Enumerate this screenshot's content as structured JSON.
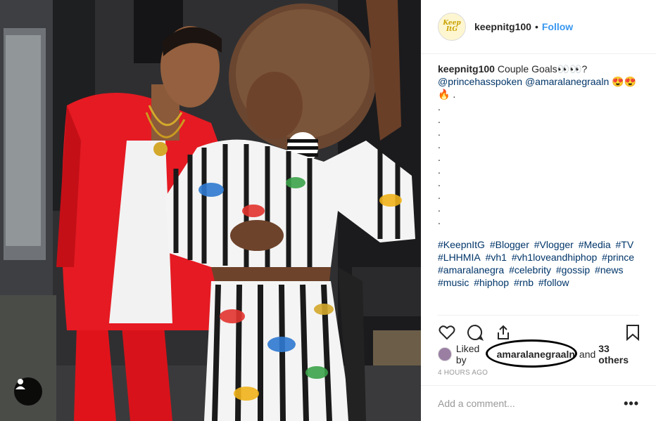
{
  "header": {
    "avatar_text": "Keep ItG",
    "username": "keepnitg100",
    "separator": "•",
    "follow_label": "Follow"
  },
  "caption": {
    "username": "keepnitg100",
    "text": "Couple Goals👀👀?",
    "mention_1": "@princehasspoken",
    "mention_2": "@amaralanegraaln",
    "emoji_1": "😍😍",
    "emoji_2": "🔥 .",
    "dots": [
      ".",
      ".",
      ".",
      ".",
      ".",
      ".",
      ".",
      ".",
      ".",
      "."
    ],
    "hashtags": [
      "#KeepnItG",
      "#Blogger",
      "#Vlogger",
      "#Media",
      "#TV",
      "#LHHMIA",
      "#vh1",
      "#vh1loveandhiphop",
      "#prince",
      "#amaralanegra",
      "#celebrity",
      "#gossip",
      "#news",
      "#music",
      "#hiphop",
      "#rnb",
      "#follow"
    ]
  },
  "actions": {
    "like": "heart-icon",
    "comment": "comment-icon",
    "share": "share-icon",
    "save": "bookmark-icon"
  },
  "likes": {
    "prefix": "Liked by",
    "liker": "amaralanegraaln",
    "suffix": "and",
    "others": "33 others"
  },
  "timestamp": "4 HOURS AGO",
  "comment": {
    "placeholder": "Add a comment...",
    "more_label": "•••"
  },
  "colors": {
    "accent": "#3897f0",
    "link": "#003569",
    "jacket_red": "#e0131b",
    "photo_bg": "#2b2b2d"
  }
}
